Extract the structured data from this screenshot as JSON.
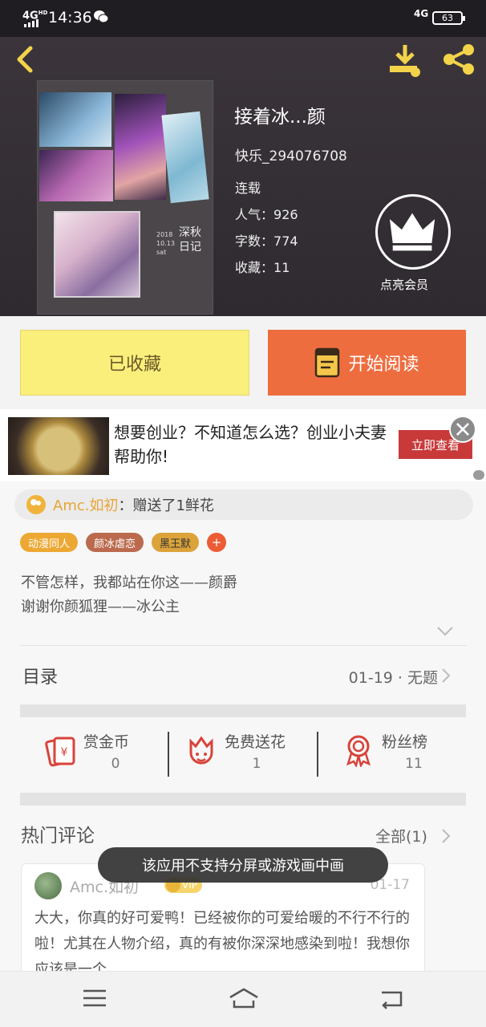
{
  "status_bar": {
    "network": "4G",
    "network_sup": "HD",
    "time": "14:36",
    "network_right": "4G",
    "battery": "63"
  },
  "header": {
    "cover": {
      "year": "2018",
      "date": "10.13",
      "day": "sat",
      "title": "深秋日记"
    },
    "title": "接着冰...颜",
    "author": "快乐_294076708",
    "status": "连载",
    "stats": [
      {
        "label": "人气：",
        "value": "926"
      },
      {
        "label": "字数：",
        "value": "774"
      },
      {
        "label": "收藏：",
        "value": "11"
      }
    ],
    "vip_label": "点亮会员"
  },
  "actions": {
    "favorite_label": "已收藏",
    "read_label": "开始阅读"
  },
  "ad": {
    "text": "想要创业？不知道怎么选？创业小夫妻帮助你!",
    "cta": "立即查看"
  },
  "gift": {
    "user": "Amc.如初",
    "text": "：赠送了1鲜花"
  },
  "tags": [
    "动漫同人",
    "颜冰虐恋",
    "黑王默"
  ],
  "tag_more": "+",
  "description": [
    "不管怎样，我都站在你这——颜爵",
    "谢谢你颜狐狸——冰公主"
  ],
  "toc": {
    "label": "目录",
    "latest": "01-19 · 无题"
  },
  "rewards": [
    {
      "label": "赏金币",
      "value": "0"
    },
    {
      "label": "免费送花",
      "value": "1"
    },
    {
      "label": "粉丝榜",
      "value": "11"
    }
  ],
  "comments": {
    "title": "热门评论",
    "all_label": "全部(1)",
    "items": [
      {
        "user": "Amc.如初",
        "badge": "VIP",
        "date": "01-17",
        "body": "大大，你真的好可爱鸭！已经被你的可爱给暖的不行不行的啦！尤其在人物介绍，真的有被你深深地感染到啦！我想你应该是一个"
      }
    ]
  },
  "toast": "该应用不支持分屏或游戏画中画",
  "colors": {
    "accent_orange": "#ee6d3f",
    "accent_yellow": "#fbef7c",
    "header_bg": "#3b353b"
  }
}
